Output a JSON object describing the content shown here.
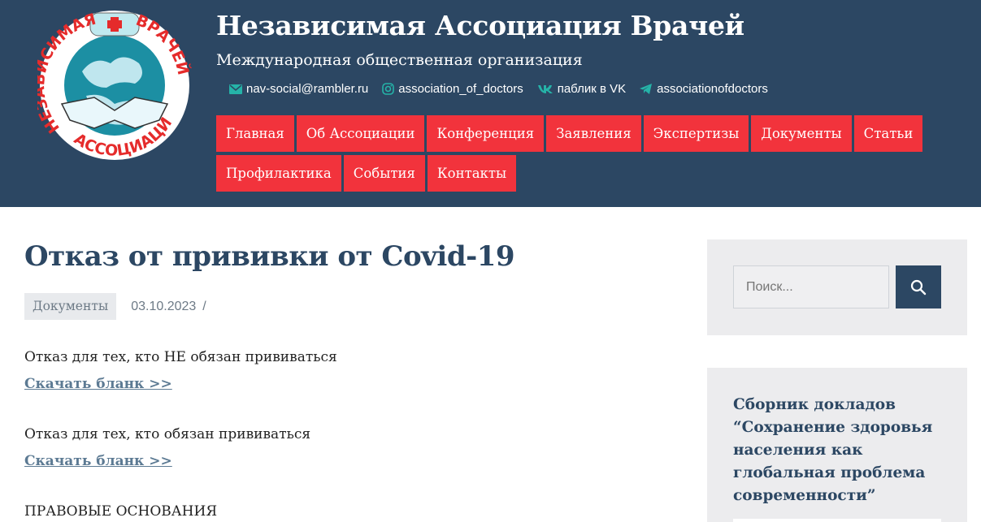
{
  "site": {
    "title": "Независимая Ассоциация Врачей",
    "subtitle": "Международная общественная организация",
    "logo_text": "НЕЗАВИСИМАЯ АССОЦИАЦИЯ ВРАЧЕЙ"
  },
  "social": [
    {
      "icon": "email-icon",
      "label": "nav-social@rambler.ru"
    },
    {
      "icon": "instagram-icon",
      "label": "association_of_doctors"
    },
    {
      "icon": "vk-icon",
      "label": "паблик в VK"
    },
    {
      "icon": "telegram-icon",
      "label": "associationofdoctors"
    }
  ],
  "nav": [
    "Главная",
    "Об Ассоциации",
    "Конференция",
    "Заявления",
    "Экспертизы",
    "Документы",
    "Статьи",
    "Профилактика",
    "События",
    "Контакты"
  ],
  "post": {
    "title": "Отказ от прививки от Covid-19",
    "category": "Документы",
    "date": "03.10.2023",
    "separator": "/",
    "p1": "Отказ для тех, кто НЕ обязан прививаться",
    "link1": "Скачать бланк >>",
    "p2": "Отказ для тех, кто обязан прививаться",
    "link2": "Скачать бланк >>",
    "p3": "ПРАВОВЫЕ ОСНОВАНИЯ"
  },
  "sidebar": {
    "search_placeholder": "Поиск...",
    "book_title": "Сборник докладов “Сохранение здоровья населения как глобальная проблема современности”"
  },
  "colors": {
    "header_bg": "#2c4763",
    "nav_bg": "#f2333c",
    "link": "#5c7a93"
  }
}
